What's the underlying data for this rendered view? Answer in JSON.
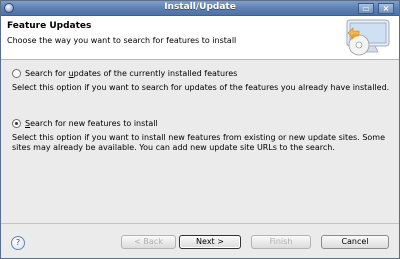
{
  "window": {
    "title": "Install/Update",
    "controls": {
      "minimize": "▭",
      "close": "×"
    }
  },
  "header": {
    "title": "Feature Updates",
    "subtitle": "Choose the way you want to search for features to install",
    "icon": "monitor-cd-icon"
  },
  "options": [
    {
      "label_prefix": "Search for ",
      "label_mnemonic": "u",
      "label_suffix": "pdates of the currently installed features",
      "selected": false,
      "description": "Select this option if you want to search for updates of the features you already have installed."
    },
    {
      "label_prefix": "",
      "label_mnemonic": "S",
      "label_suffix": "earch for new features to install",
      "selected": true,
      "description": "Select this option if you want to install new features from existing or new update sites. Some sites may already be available. You can add new update site URLs to the search."
    }
  ],
  "buttons": {
    "help": "?",
    "back": "< Back",
    "next": "Next >",
    "finish": "Finish",
    "cancel": "Cancel"
  },
  "colors": {
    "titlebar": "#5b7fb0",
    "dialog_bg": "#ebebeb",
    "banner_bg": "#ffffff"
  }
}
